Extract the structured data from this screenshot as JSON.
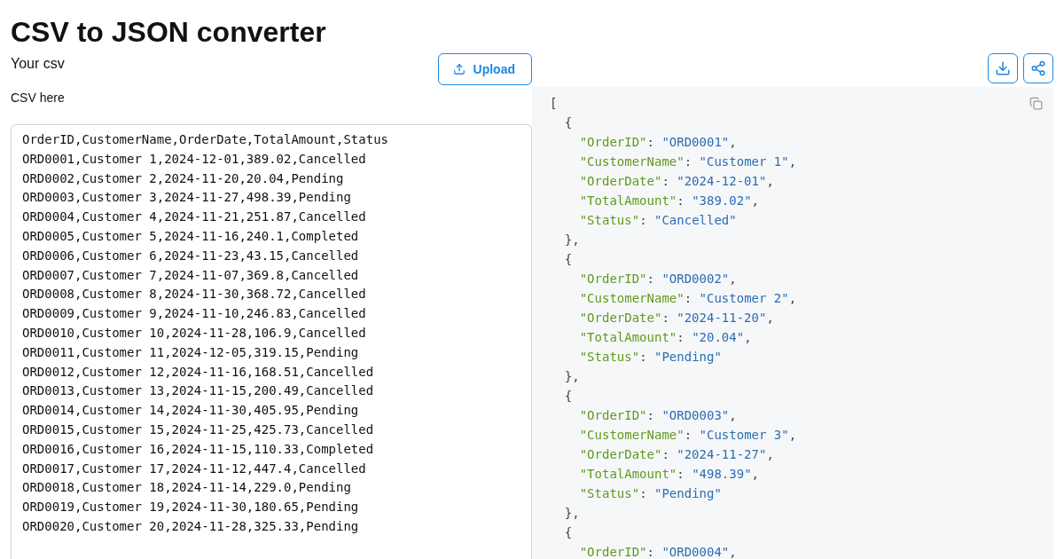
{
  "title": "CSV to JSON converter",
  "input": {
    "label": "Your csv",
    "upload_button": "Upload",
    "field_label": "CSV here",
    "value_lines": [
      "OrderID,CustomerName,OrderDate,TotalAmount,Status",
      "ORD0001,Customer 1,2024-12-01,389.02,Cancelled",
      "ORD0002,Customer 2,2024-11-20,20.04,Pending",
      "ORD0003,Customer 3,2024-11-27,498.39,Pending",
      "ORD0004,Customer 4,2024-11-21,251.87,Cancelled",
      "ORD0005,Customer 5,2024-11-16,240.1,Completed",
      "ORD0006,Customer 6,2024-11-23,43.15,Cancelled",
      "ORD0007,Customer 7,2024-11-07,369.8,Cancelled",
      "ORD0008,Customer 8,2024-11-30,368.72,Cancelled",
      "ORD0009,Customer 9,2024-11-10,246.83,Cancelled",
      "ORD0010,Customer 10,2024-11-28,106.9,Cancelled",
      "ORD0011,Customer 11,2024-12-05,319.15,Pending",
      "ORD0012,Customer 12,2024-11-16,168.51,Cancelled",
      "ORD0013,Customer 13,2024-11-15,200.49,Cancelled",
      "ORD0014,Customer 14,2024-11-30,405.95,Pending",
      "ORD0015,Customer 15,2024-11-25,425.73,Cancelled",
      "ORD0016,Customer 16,2024-11-15,110.33,Completed",
      "ORD0017,Customer 17,2024-11-12,447.4,Cancelled",
      "ORD0018,Customer 18,2024-11-14,229.0,Pending",
      "ORD0019,Customer 19,2024-11-30,180.65,Pending",
      "ORD0020,Customer 20,2024-11-28,325.33,Pending"
    ]
  },
  "output": {
    "lines": [
      {
        "tokens": [
          {
            "kind": "punct",
            "text": "["
          }
        ],
        "children": [
          {
            "tokens": [
              {
                "kind": "punct",
                "text": "{"
              }
            ],
            "children": [
              {
                "tokens": [
                  {
                    "kind": "key",
                    "text": "\"OrderID\""
                  },
                  {
                    "kind": "punct",
                    "text": ":"
                  },
                  {
                    "kind": "string",
                    "text": "\"ORD0001\""
                  },
                  {
                    "kind": "punct",
                    "text": ","
                  }
                ]
              },
              {
                "tokens": [
                  {
                    "kind": "key",
                    "text": "\"CustomerName\""
                  },
                  {
                    "kind": "punct",
                    "text": ":"
                  },
                  {
                    "kind": "string",
                    "text": "\"Customer 1\""
                  },
                  {
                    "kind": "punct",
                    "text": ","
                  }
                ]
              },
              {
                "tokens": [
                  {
                    "kind": "key",
                    "text": "\"OrderDate\""
                  },
                  {
                    "kind": "punct",
                    "text": ":"
                  },
                  {
                    "kind": "string",
                    "text": "\"2024-12-01\""
                  },
                  {
                    "kind": "punct",
                    "text": ","
                  }
                ]
              },
              {
                "tokens": [
                  {
                    "kind": "key",
                    "text": "\"TotalAmount\""
                  },
                  {
                    "kind": "punct",
                    "text": ":"
                  },
                  {
                    "kind": "string",
                    "text": "\"389.02\""
                  },
                  {
                    "kind": "punct",
                    "text": ","
                  }
                ]
              },
              {
                "tokens": [
                  {
                    "kind": "key",
                    "text": "\"Status\""
                  },
                  {
                    "kind": "punct",
                    "text": ":"
                  },
                  {
                    "kind": "string",
                    "text": "\"Cancelled\""
                  }
                ]
              }
            ]
          },
          {
            "tokens": [
              {
                "kind": "punct",
                "text": "},"
              }
            ]
          },
          {
            "tokens": [
              {
                "kind": "punct",
                "text": "{"
              }
            ],
            "children": [
              {
                "tokens": [
                  {
                    "kind": "key",
                    "text": "\"OrderID\""
                  },
                  {
                    "kind": "punct",
                    "text": ":"
                  },
                  {
                    "kind": "string",
                    "text": "\"ORD0002\""
                  },
                  {
                    "kind": "punct",
                    "text": ","
                  }
                ]
              },
              {
                "tokens": [
                  {
                    "kind": "key",
                    "text": "\"CustomerName\""
                  },
                  {
                    "kind": "punct",
                    "text": ":"
                  },
                  {
                    "kind": "string",
                    "text": "\"Customer 2\""
                  },
                  {
                    "kind": "punct",
                    "text": ","
                  }
                ]
              },
              {
                "tokens": [
                  {
                    "kind": "key",
                    "text": "\"OrderDate\""
                  },
                  {
                    "kind": "punct",
                    "text": ":"
                  },
                  {
                    "kind": "string",
                    "text": "\"2024-11-20\""
                  },
                  {
                    "kind": "punct",
                    "text": ","
                  }
                ]
              },
              {
                "tokens": [
                  {
                    "kind": "key",
                    "text": "\"TotalAmount\""
                  },
                  {
                    "kind": "punct",
                    "text": ":"
                  },
                  {
                    "kind": "string",
                    "text": "\"20.04\""
                  },
                  {
                    "kind": "punct",
                    "text": ","
                  }
                ]
              },
              {
                "tokens": [
                  {
                    "kind": "key",
                    "text": "\"Status\""
                  },
                  {
                    "kind": "punct",
                    "text": ":"
                  },
                  {
                    "kind": "string",
                    "text": "\"Pending\""
                  }
                ]
              }
            ]
          },
          {
            "tokens": [
              {
                "kind": "punct",
                "text": "},"
              }
            ]
          },
          {
            "tokens": [
              {
                "kind": "punct",
                "text": "{"
              }
            ],
            "children": [
              {
                "tokens": [
                  {
                    "kind": "key",
                    "text": "\"OrderID\""
                  },
                  {
                    "kind": "punct",
                    "text": ":"
                  },
                  {
                    "kind": "string",
                    "text": "\"ORD0003\""
                  },
                  {
                    "kind": "punct",
                    "text": ","
                  }
                ]
              },
              {
                "tokens": [
                  {
                    "kind": "key",
                    "text": "\"CustomerName\""
                  },
                  {
                    "kind": "punct",
                    "text": ":"
                  },
                  {
                    "kind": "string",
                    "text": "\"Customer 3\""
                  },
                  {
                    "kind": "punct",
                    "text": ","
                  }
                ]
              },
              {
                "tokens": [
                  {
                    "kind": "key",
                    "text": "\"OrderDate\""
                  },
                  {
                    "kind": "punct",
                    "text": ":"
                  },
                  {
                    "kind": "string",
                    "text": "\"2024-11-27\""
                  },
                  {
                    "kind": "punct",
                    "text": ","
                  }
                ]
              },
              {
                "tokens": [
                  {
                    "kind": "key",
                    "text": "\"TotalAmount\""
                  },
                  {
                    "kind": "punct",
                    "text": ":"
                  },
                  {
                    "kind": "string",
                    "text": "\"498.39\""
                  },
                  {
                    "kind": "punct",
                    "text": ","
                  }
                ]
              },
              {
                "tokens": [
                  {
                    "kind": "key",
                    "text": "\"Status\""
                  },
                  {
                    "kind": "punct",
                    "text": ":"
                  },
                  {
                    "kind": "string",
                    "text": "\"Pending\""
                  }
                ]
              }
            ]
          },
          {
            "tokens": [
              {
                "kind": "punct",
                "text": "},"
              }
            ]
          },
          {
            "tokens": [
              {
                "kind": "punct",
                "text": "{"
              }
            ],
            "children": [
              {
                "tokens": [
                  {
                    "kind": "key",
                    "text": "\"OrderID\""
                  },
                  {
                    "kind": "punct",
                    "text": ":"
                  },
                  {
                    "kind": "string",
                    "text": "\"ORD0004\""
                  },
                  {
                    "kind": "punct",
                    "text": ","
                  }
                ]
              }
            ]
          }
        ]
      }
    ]
  }
}
